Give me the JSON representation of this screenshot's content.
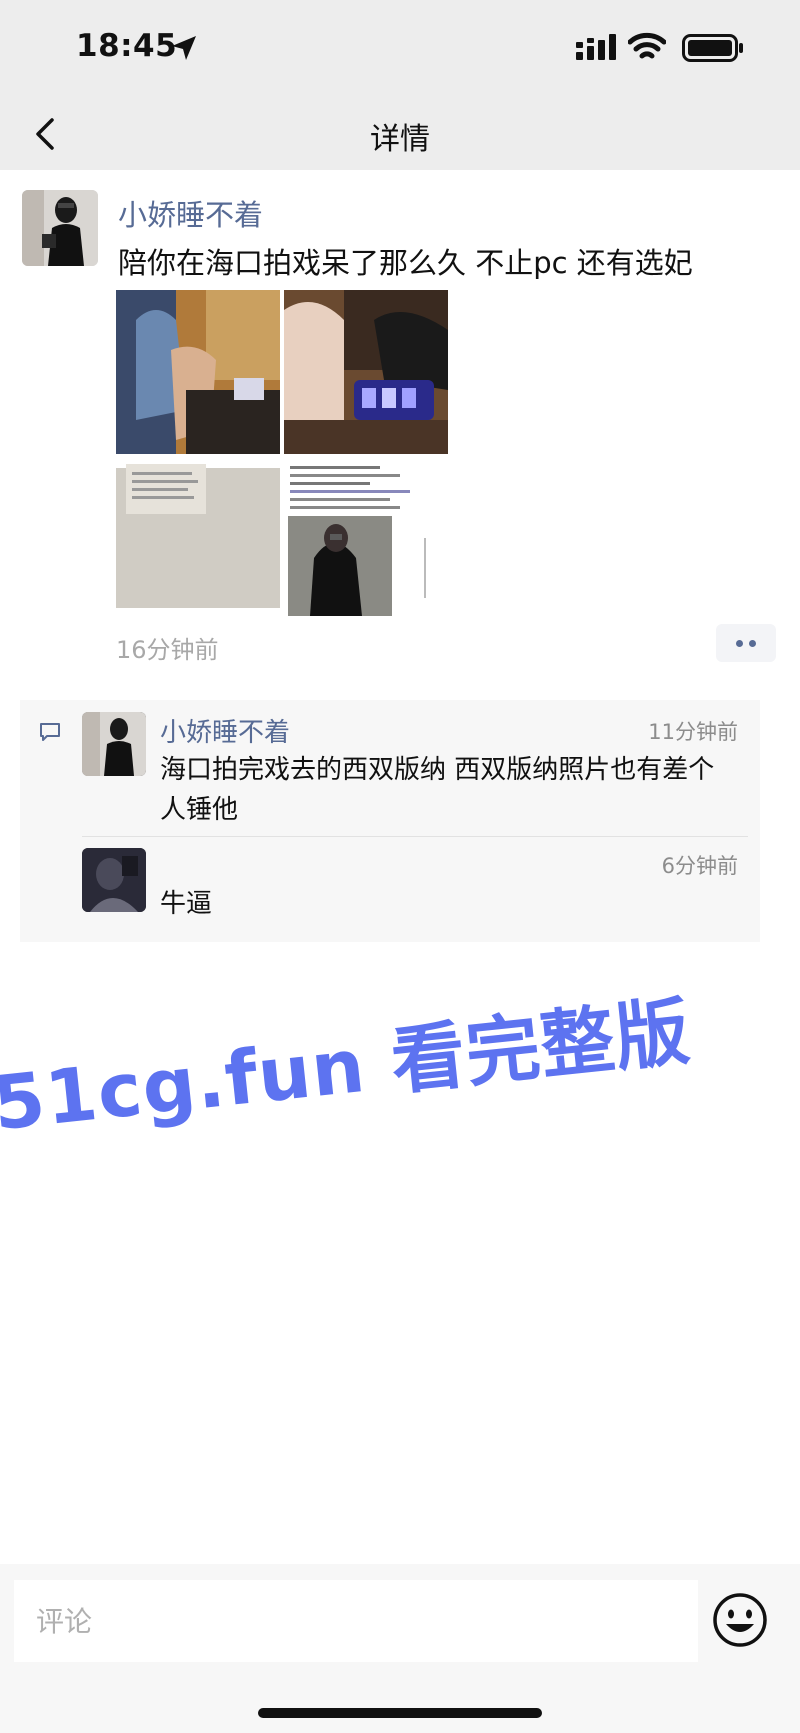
{
  "status_bar": {
    "time": "18:45"
  },
  "nav": {
    "title": "详情"
  },
  "post": {
    "author": "小娇睡不着",
    "text": "陪你在海口拍戏呆了那么久 不止pc 还有选妃",
    "images": [
      {
        "id": "photo-1"
      },
      {
        "id": "photo-2"
      },
      {
        "id": "photo-3"
      },
      {
        "id": "photo-4"
      }
    ],
    "time": "16分钟前"
  },
  "comments": [
    {
      "author": "小娇睡不着",
      "time": "11分钟前",
      "text": "海口拍完戏去的西双版纳 西双版纳照片也有差个人锤他"
    },
    {
      "author": "",
      "time": "6分钟前",
      "text": "牛逼"
    }
  ],
  "watermark": {
    "text": "51cg.fun 看完整版"
  },
  "input": {
    "placeholder": "评论"
  },
  "colors": {
    "link": "#576b95",
    "watermark": "#5d73f0",
    "bar": "#ededed"
  },
  "icons": [
    "location-arrow-icon",
    "signal-icon",
    "wifi-icon",
    "battery-icon",
    "back-chevron-icon",
    "more-dots-icon",
    "comment-bubble-icon",
    "emoji-icon"
  ]
}
